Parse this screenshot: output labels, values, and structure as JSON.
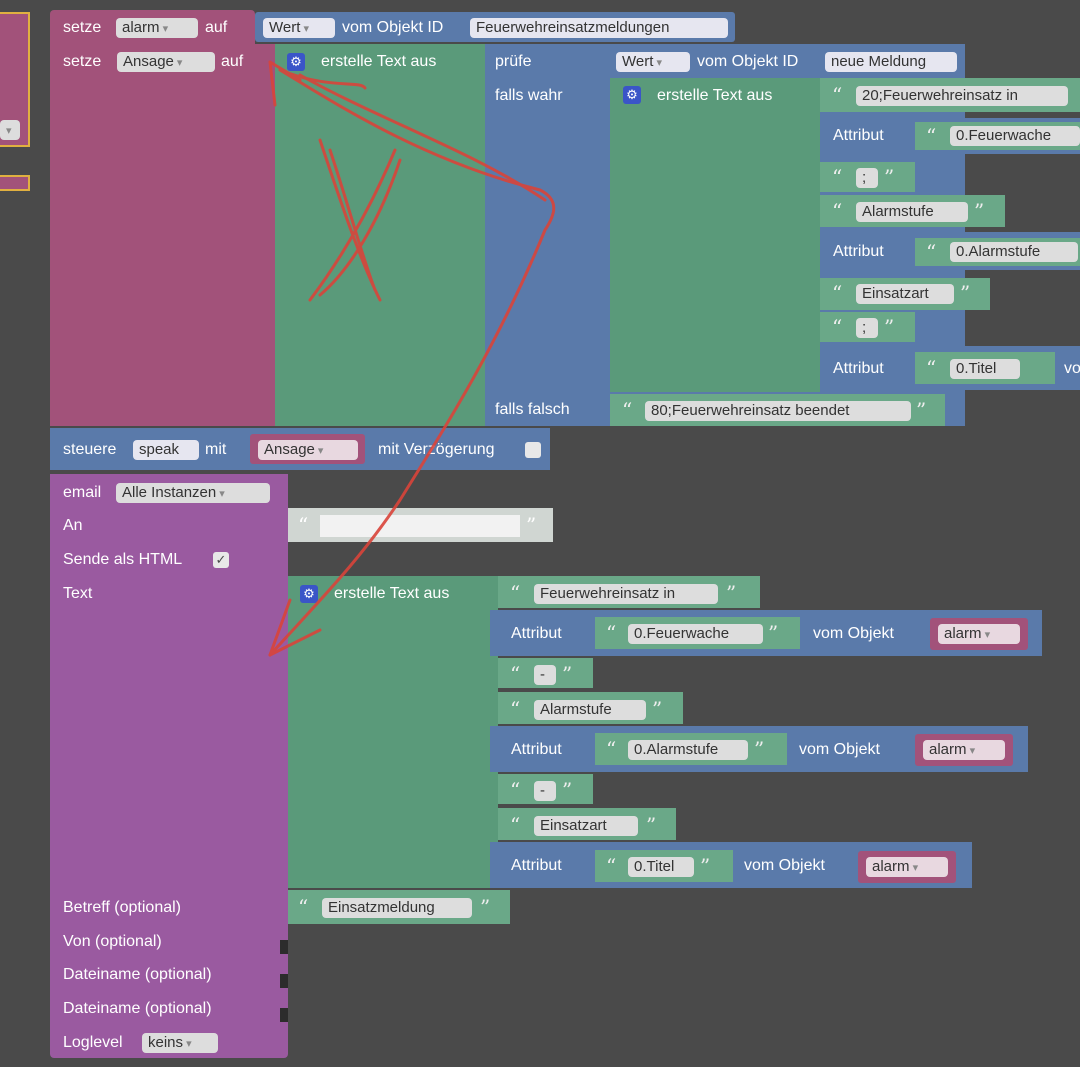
{
  "row1": {
    "setze": "setze",
    "var": "alarm",
    "auf": "auf",
    "wert": "Wert",
    "vom": "vom Objekt ID",
    "id": "Feuerwehreinsatzmeldungen"
  },
  "row2": {
    "setze": "setze",
    "var": "Ansage",
    "auf": "auf",
    "create": "erstelle Text aus"
  },
  "pruefe": {
    "label": "prüfe",
    "wert": "Wert",
    "vom": "vom Objekt ID",
    "id": "neue Meldung",
    "true_label": "falls wahr",
    "false_label": "falls falsch",
    "false_text": "80;Feuerwehreinsatz beendet"
  },
  "inner": {
    "create": "erstelle Text aus",
    "t1": "20;Feuerwehreinsatz in",
    "attr1_label": "Attribut",
    "attr1_val": "0.Feuerwache",
    "sep1": ";",
    "t2": "Alarmstufe",
    "attr2_label": "Attribut",
    "attr2_val": "0.Alarmstufe",
    "t3": "Einsatzart",
    "sep2": ";",
    "attr3_label": "Attribut",
    "attr3_val": "0.Titel",
    "attr3_tail": "vo"
  },
  "speak": {
    "label": "steuere",
    "var": "speak",
    "mit": "mit",
    "val": "Ansage",
    "delay": "mit Verzögerung"
  },
  "email": {
    "label": "email",
    "instances": "Alle Instanzen",
    "an": "An",
    "html": "Sende als HTML",
    "text": "Text",
    "betreff": "Betreff (optional)",
    "betreff_val": "Einsatzmeldung",
    "von": "Von (optional)",
    "datei1": "Dateiname (optional)",
    "datei2": "Dateiname (optional)",
    "loglevel": "Loglevel",
    "loglevel_val": "keins"
  },
  "mail_text": {
    "create": "erstelle Text aus",
    "t1": "Feuerwehreinsatz in",
    "attr1": "Attribut",
    "attr1_val": "0.Feuerwache",
    "obj1": "vom Objekt",
    "obj1_val": "alarm",
    "sep1": "-",
    "t2": "Alarmstufe",
    "attr2": "Attribut",
    "attr2_val": "0.Alarmstufe",
    "obj2": "vom Objekt",
    "obj2_val": "alarm",
    "sep2": "-",
    "t3": "Einsatzart",
    "attr3": "Attribut",
    "attr3_val": "0.Titel",
    "obj3": "vom Objekt",
    "obj3_val": "alarm"
  },
  "colors": {
    "set": "#a2527a",
    "text": "#5a9a7a",
    "logic": "#5a7aaa",
    "email": "#9a5aa0",
    "annotation": "#d9443a"
  }
}
